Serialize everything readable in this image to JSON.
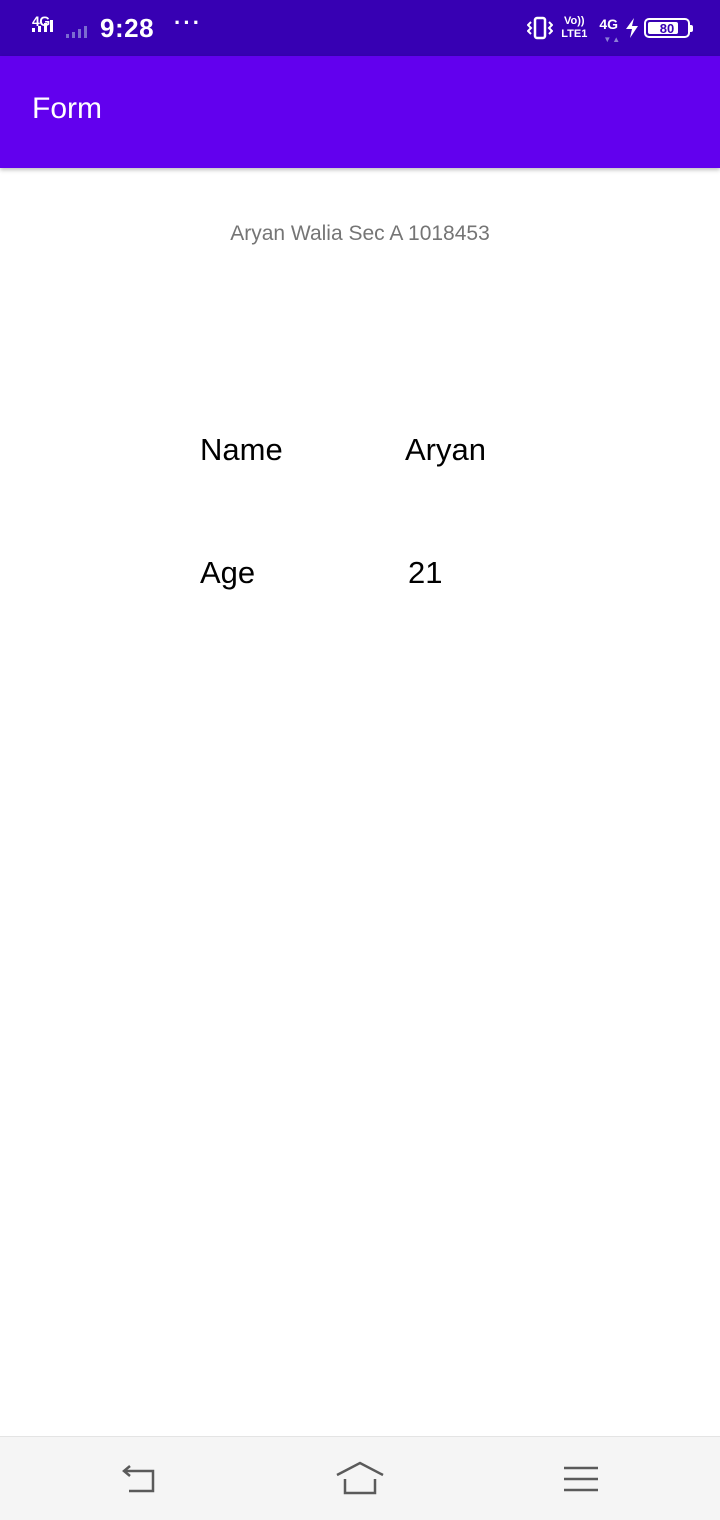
{
  "status_bar": {
    "network_left": "4G",
    "time": "9:28",
    "overflow": "···",
    "volte_top": "Vo))",
    "volte_bottom": "LTE1",
    "network_right": "4G",
    "battery_level": 80,
    "battery_text": "80",
    "icons": [
      "signal-icon",
      "vibrate-icon",
      "charging-icon",
      "battery-icon"
    ]
  },
  "app_bar": {
    "title": "Form",
    "color": "#6200EE",
    "status_color": "#3700B3"
  },
  "content": {
    "subtitle": "Aryan Walia Sec A 1018453",
    "rows": [
      {
        "label": "Name",
        "value": "Aryan"
      },
      {
        "label": "Age",
        "value": "21"
      }
    ]
  },
  "nav_bar": {
    "icons": [
      "back-icon",
      "home-icon",
      "menu-icon"
    ]
  }
}
